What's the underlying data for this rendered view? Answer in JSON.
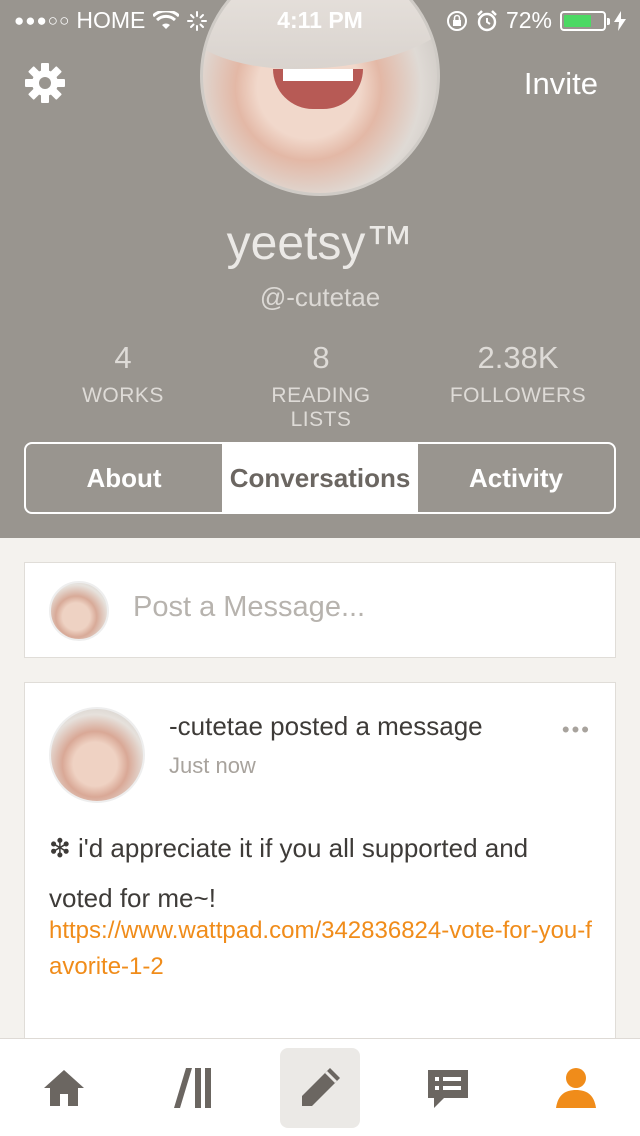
{
  "status_bar": {
    "carrier": "HOME",
    "signal_dots": "●●●○○",
    "time": "4:11 PM",
    "battery": "72%",
    "battery_level": 0.72
  },
  "header": {
    "invite_label": "Invite",
    "username": "yeetsy™",
    "handle": "@-cutetae"
  },
  "stats": [
    {
      "value": "4",
      "label": "WORKS"
    },
    {
      "value": "8",
      "label": "READING LISTS"
    },
    {
      "value": "2.38K",
      "label": "FOLLOWERS"
    }
  ],
  "tabs": [
    {
      "label": "About",
      "active": false
    },
    {
      "label": "Conversations",
      "active": true
    },
    {
      "label": "Activity",
      "active": false
    }
  ],
  "composer": {
    "placeholder": "Post a Message..."
  },
  "post": {
    "title": "-cutetae posted a message",
    "time": "Just now",
    "more": "•••",
    "body": "❇ i'd appreciate it if you all supported and voted for me~!",
    "link": "https://www.wattpad.com/342836824-vote-for-you-favorite-1-2"
  },
  "nav": [
    {
      "icon": "home-icon"
    },
    {
      "icon": "library-icon"
    },
    {
      "icon": "pencil-icon"
    },
    {
      "icon": "messages-icon"
    },
    {
      "icon": "profile-icon"
    }
  ],
  "colors": {
    "header_bg": "#99958f",
    "accent": "#f08c1a",
    "nav_icon": "#6b6661"
  }
}
